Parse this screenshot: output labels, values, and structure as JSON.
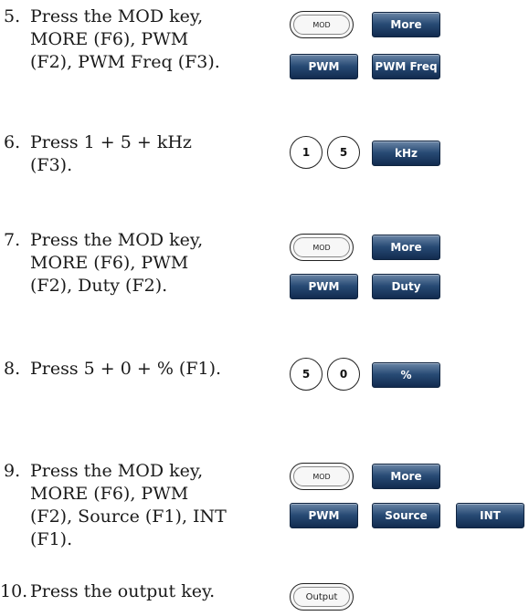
{
  "steps": [
    {
      "num": "5.",
      "text": "Press the MOD key,\nMORE (F6), PWM\n(F2), PWM Freq (F3).",
      "keys": {
        "mod": "MOD",
        "more": "More",
        "pwm": "PWM",
        "pwm_freq": "PWM Freq"
      }
    },
    {
      "num": "6.",
      "text": "Press 1 + 5 + kHz\n(F3).",
      "keys": {
        "one": "1",
        "five": "5",
        "khz": "kHz"
      }
    },
    {
      "num": "7.",
      "text": "Press the MOD key,\nMORE (F6), PWM\n(F2), Duty (F2).",
      "keys": {
        "mod": "MOD",
        "more": "More",
        "pwm": "PWM",
        "duty": "Duty"
      }
    },
    {
      "num": "8.",
      "text": "Press 5 + 0 + % (F1).",
      "keys": {
        "five": "5",
        "zero": "0",
        "percent": "%"
      }
    },
    {
      "num": "9.",
      "text": "Press the MOD key,\nMORE (F6), PWM\n(F2), Source (F1), INT\n(F1).",
      "keys": {
        "mod": "MOD",
        "more": "More",
        "pwm": "PWM",
        "source": "Source",
        "int": "INT"
      }
    },
    {
      "num": "10.",
      "text": "Press the output key.",
      "keys": {
        "output": "Output"
      }
    }
  ]
}
